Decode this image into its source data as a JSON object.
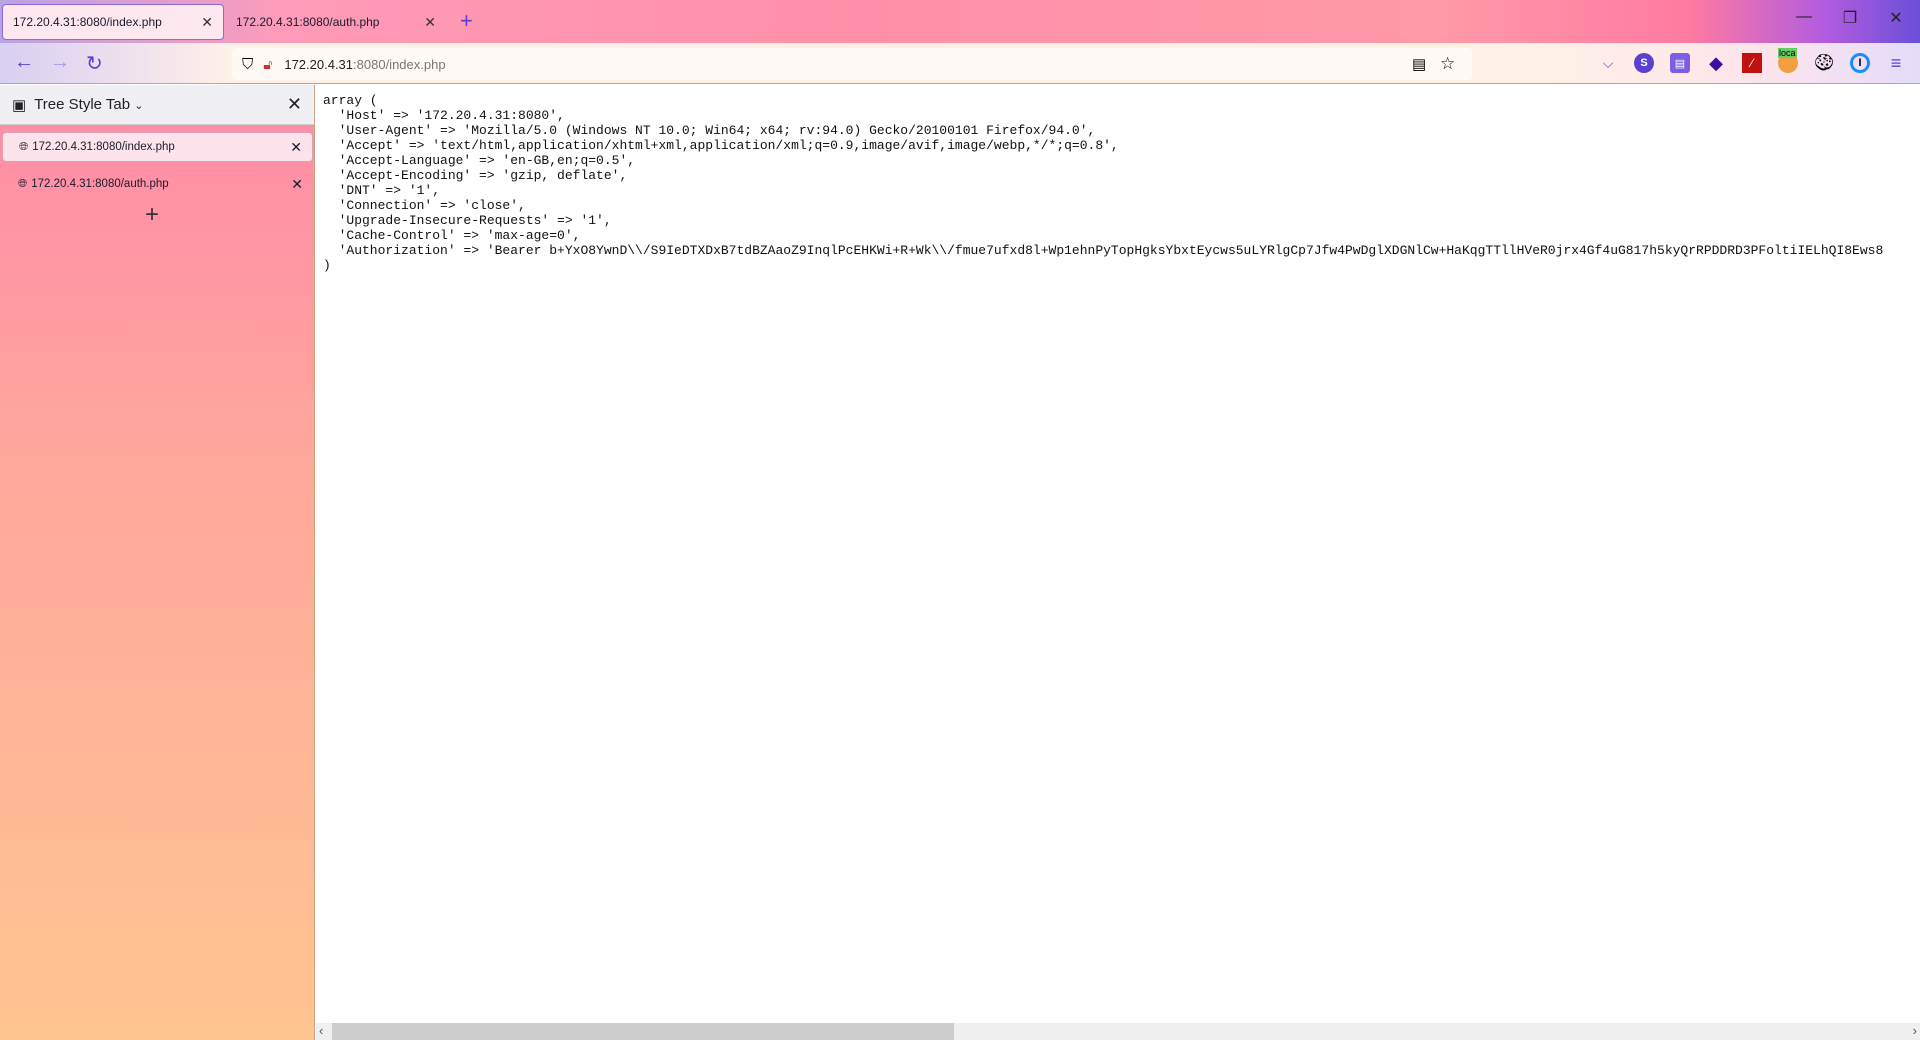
{
  "tabs": [
    {
      "label": "172.20.4.31:8080/index.php",
      "active": true
    },
    {
      "label": "172.20.4.31:8080/auth.php",
      "active": false
    }
  ],
  "url": {
    "host": "172.20.4.31",
    "path": ":8080/index.php"
  },
  "sidebar": {
    "title": "Tree Style Tab",
    "tabs": [
      {
        "label": "172.20.4.31:8080/index.php"
      },
      {
        "label": "172.20.4.31:8080/auth.php"
      }
    ]
  },
  "extensions": {
    "badge": "loca"
  },
  "content": {
    "lines": [
      "array (",
      "  'Host' => '172.20.4.31:8080',",
      "  'User-Agent' => 'Mozilla/5.0 (Windows NT 10.0; Win64; x64; rv:94.0) Gecko/20100101 Firefox/94.0',",
      "  'Accept' => 'text/html,application/xhtml+xml,application/xml;q=0.9,image/avif,image/webp,*/*;q=0.8',",
      "  'Accept-Language' => 'en-GB,en;q=0.5',",
      "  'Accept-Encoding' => 'gzip, deflate',",
      "  'DNT' => '1',",
      "  'Connection' => 'close',",
      "  'Upgrade-Insecure-Requests' => '1',",
      "  'Cache-Control' => 'max-age=0',",
      "  'Authorization' => 'Bearer b+YxO8YwnD\\\\/S9IeDTXDxB7tdBZAaoZ9InqlPcEHKWi+R+Wk\\\\/fmue7ufxd8l+Wp1ehnPyTopHgksYbxtEycws5uLYRlgCp7Jfw4PwDglXDGNlCw+HaKqgTTllHVeR0jrx4Gf4uG817h5kyQrRPDDRD3PFoltiIELhQI8Ews8",
      ")"
    ]
  }
}
